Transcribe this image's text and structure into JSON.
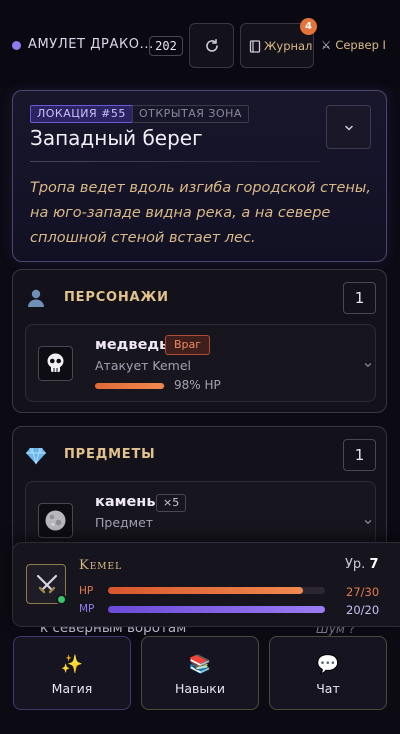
{
  "topbar": {
    "amulet_label": "АМУЛЕТ ДРАКО...",
    "amulet_count": "202",
    "journal_label": "Журнал",
    "journal_badge": "4",
    "server_label": "Сервер I",
    "icons": [
      "refresh-icon",
      "book-icon",
      "crossed-swords-icon"
    ]
  },
  "location": {
    "tag": "ЛОКАЦИЯ #55",
    "zone": "ОТКРЫТАЯ ЗОНА",
    "title": "Западный берег",
    "description": "Тропа ведет вдоль изгиба городской стены, на юго-западе видна река, а на севере сплошной стеной встает лес."
  },
  "characters": {
    "title": "ПЕРСОНАЖИ",
    "count": "1",
    "items": [
      {
        "name": "медведь",
        "tag": "Враг",
        "status": "Атакует Kemel",
        "hp_percent": 98,
        "hp_text": "98% HP",
        "icon": "skull-icon"
      }
    ]
  },
  "items": {
    "title": "ПРЕДМЕТЫ",
    "count": "1",
    "list": [
      {
        "name": "камень",
        "qty": "×5",
        "type": "Предмет",
        "icon": "stone-icon"
      }
    ]
  },
  "obscured": {
    "path_text": "к северным воротам",
    "noise_text": "Шум ?"
  },
  "player": {
    "name": "Kemel",
    "level_label": "Ур.",
    "level": "7",
    "hp_label": "HP",
    "hp": 27,
    "hp_max": 30,
    "hp_text": "27/30",
    "mp_label": "MP",
    "mp": 20,
    "mp_max": 20,
    "mp_text": "20/20"
  },
  "nav": [
    {
      "label": "Магия",
      "icon": "sparkles-icon"
    },
    {
      "label": "Навыки",
      "icon": "books-icon"
    },
    {
      "label": "Чат",
      "icon": "speech-bubble-icon"
    }
  ],
  "colors": {
    "accent_gold": "#d9b987",
    "accent_purple": "#8f7cf0",
    "hp": "#e07a4e",
    "enemy": "#f08a66",
    "online": "#39c66a"
  }
}
